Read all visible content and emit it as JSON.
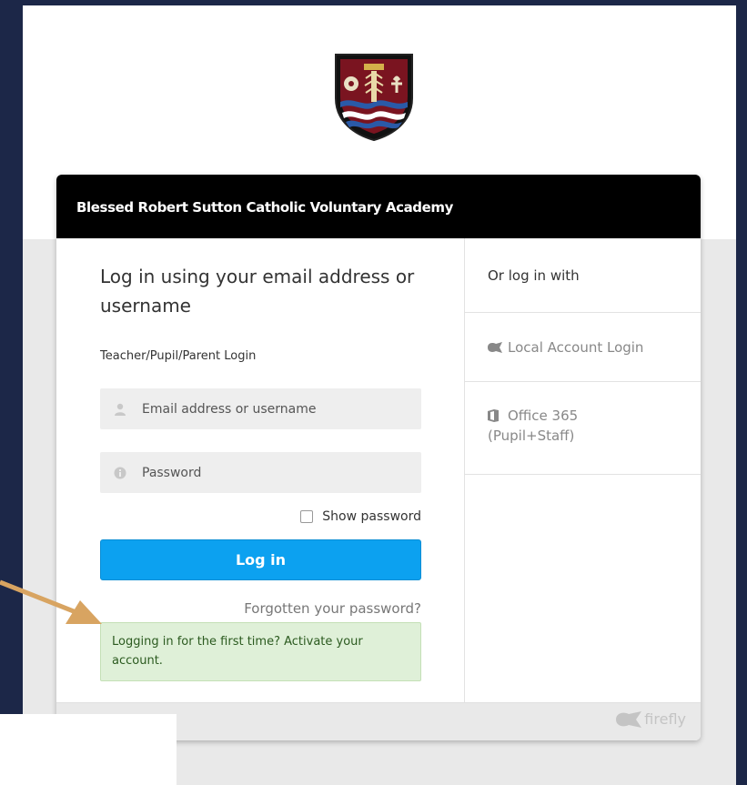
{
  "school": {
    "name": "Blessed Robert Sutton Catholic Voluntary Academy"
  },
  "login": {
    "title": "Log in using your email address or username",
    "subtitle": "Teacher/Pupil/Parent Login",
    "email_placeholder": "Email address or username",
    "password_placeholder": "Password",
    "show_password": "Show password",
    "login_button": "Log in",
    "forgot": "Forgotten your password?",
    "activate": "Logging in for the first time? Activate your account."
  },
  "alt_login": {
    "heading": "Or log in with",
    "local": "Local Account Login",
    "office_line1": "Office 365",
    "office_line2": "(Pupil+Staff)"
  },
  "footer": {
    "brand": "firefly"
  },
  "colors": {
    "background": "#1c2748",
    "header": "#000000",
    "button": "#0ca1f0",
    "alert_bg": "#dff0d8",
    "arrow": "#d8a461"
  }
}
